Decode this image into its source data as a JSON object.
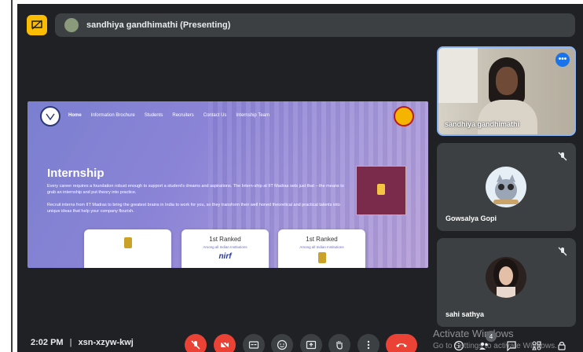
{
  "presenter": {
    "label": "sandhiya gandhimathi (Presenting)"
  },
  "shared_screen": {
    "nav": [
      "Home",
      "Information Brochure",
      "Students",
      "Recruiters",
      "Contact Us",
      "Internship Team"
    ],
    "heading": "Internship",
    "paragraph1": "Every career requires a foundation robust enough to support a student's dreams and aspirations. The Intern-ship at IIT Madras sets just that – the means to grab an internship and put theory into practice.",
    "paragraph2": "Recruit interns from IIT Madras to bring the greatest brains in India to work for you, so they transform their well honed theoretical and practical talents into unique ideas that help your company flourish.",
    "cards": [
      {
        "title": "",
        "subtitle": ""
      },
      {
        "title": "1st Ranked",
        "subtitle": "Among all Indian Institutions",
        "logo_text": "nirf"
      },
      {
        "title": "1st Ranked",
        "subtitle": "Among all Indian Institutions"
      }
    ]
  },
  "participants": [
    {
      "name": "sandhiya gandhimathi",
      "more_label": "•••"
    },
    {
      "name": "Gowsalya Gopi"
    },
    {
      "name": "sahi sathya"
    }
  ],
  "bottom_bar": {
    "time": "2:02 PM",
    "separator": "|",
    "meeting_code": "xsn-xzyw-kwj",
    "participant_count": "4",
    "icons": [
      "mic-off-icon",
      "camera-off-icon",
      "captions-icon",
      "emoji-icon",
      "present-icon",
      "raise-hand-icon",
      "more-options-icon",
      "end-call-icon",
      "info-icon",
      "people-icon",
      "chat-icon",
      "activities-icon",
      "lock-icon"
    ]
  },
  "watermark": {
    "line1": "Activate Windows",
    "line2": "Go to Settings to activate Windows."
  },
  "colors": {
    "background": "#202124",
    "tile": "#3c4043",
    "accent_yellow": "#fbbc04",
    "accent_red": "#ea4335",
    "accent_blue": "#8ab4f8"
  }
}
